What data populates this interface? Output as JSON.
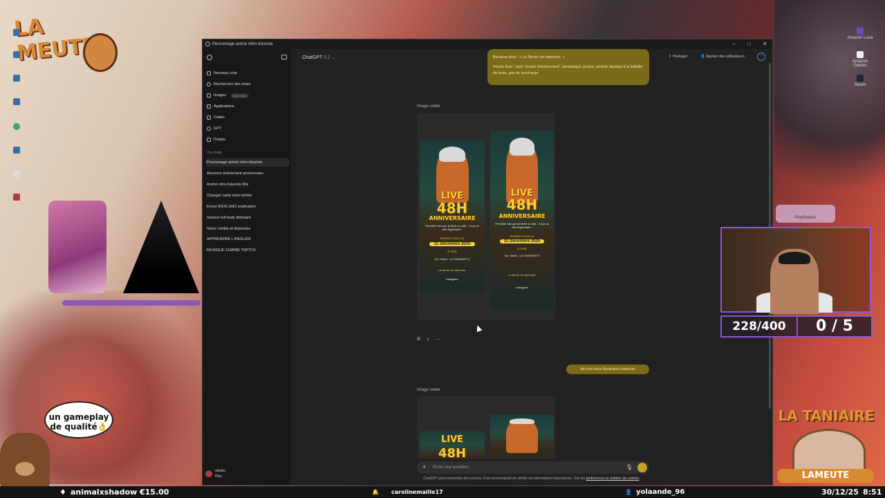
{
  "desktop": {
    "left_icons": [
      "",
      "",
      "",
      "",
      "",
      "",
      "",
      ""
    ],
    "right_icons": [
      "Amazon Luna",
      "Amazon Games",
      "Steam"
    ],
    "logo_text": "LA MEUTE",
    "speech_bubble": "un gameplay de qualité👌",
    "playstation_label": "PlayStation"
  },
  "window": {
    "title": "Personnage animé rétro-futuriste",
    "controls": {
      "minimize": "–",
      "maximize": "□",
      "close": "✕"
    }
  },
  "sidebar": {
    "nav": [
      {
        "label": "Nouveau chat",
        "icon": "edit-icon"
      },
      {
        "label": "Rechercher des chats",
        "icon": "search-icon"
      },
      {
        "label": "Images",
        "icon": "image-icon",
        "badge": "NOUVEAU"
      },
      {
        "label": "Applications",
        "icon": "apps-icon"
      },
      {
        "label": "Codex",
        "icon": "codex-icon"
      },
      {
        "label": "GPT",
        "icon": "gpt-icon"
      },
      {
        "label": "Projets",
        "icon": "folder-icon"
      }
    ],
    "section_title": "Vos chats",
    "chats": [
      "Personnage animé rétro-futuriste",
      "Annonce événement anniversaire",
      "Animé rétro-futuriste 80s",
      "Changer carte mère boîtier",
      "Erreur BIOS 0x81 explication",
      "Séance full body débutant",
      "Gérer crédits et dépenses",
      "APPRENDRE L'ANGLAIS",
      "MUSIQUE CHAINE TWITCH"
    ],
    "active_index": 0,
    "user": {
      "name": "obinho",
      "plan": "Plus"
    }
  },
  "header": {
    "model": "ChatGPT",
    "version": "5.2",
    "share": "Partager",
    "add_users": "Ajouter des utilisateurs"
  },
  "conversation": {
    "user_message_1": {
      "line1": "Bandeau final : « La Meute est attendue. »",
      "line2": "Rendu final : style \"poster d'événement\", dynamique, propre, priorité absolue à la lisibilité du texte, pas de surcharge."
    },
    "image_label_1": "Image créée",
    "poster": {
      "live": "LIVE",
      "hours": "48H",
      "subtitle": "ANNIVERSAIRE",
      "tagline": "Première fois que je tente un 48h... et ça va être légendaire !",
      "rdv": "RENDEZ-VOUS LE",
      "date": "31 Décembre 2025",
      "time": "À 7H30",
      "twitch": "Sur Twitch : LA TANIAIRETV",
      "footer": "La Meute est attendue.",
      "instagram": "Instagram"
    },
    "user_message_2": "fait moi deux illustration distincte",
    "image_label_2": "Image créée"
  },
  "composer": {
    "placeholder": "Poser une question",
    "disclaimer_prefix": "ChatGPT peut commettre des erreurs. Il est recommandé de vérifier les informations importantes. Voir les ",
    "disclaimer_link": "préférences en matière de cookies",
    "disclaimer_suffix": "."
  },
  "overlay": {
    "counter_left": "228/400",
    "counter_right": "0 / 5",
    "brand_top": "LA TANIAIRE",
    "brand_bottom": "LAMEUTE"
  },
  "ticker": {
    "item1": "animalxshadow €15.00",
    "item2": "carolinemaille17",
    "item3": "yolaande_96",
    "date": "30/12/25",
    "time": "8:51"
  },
  "colors": {
    "accent_gold": "#c9a322",
    "user_bubble": "#7a6a1a",
    "frame_purple": "#8a5ad0"
  }
}
